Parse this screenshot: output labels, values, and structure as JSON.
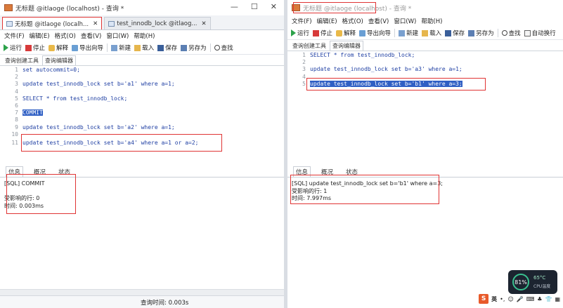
{
  "left": {
    "window_title": "无标题 @itlaoge (localhost) - 查询 *",
    "window_controls": {
      "minimize": "—",
      "maximize": "☐",
      "close": "✕"
    },
    "tabs": [
      {
        "label": "无标题 @itlaoge (localh...",
        "close": "✕"
      },
      {
        "label": "test_innodb_lock @itlaog...",
        "close": "✕"
      }
    ],
    "menu": [
      "文件(F)",
      "编辑(E)",
      "格式(O)",
      "查看(V)",
      "窗口(W)",
      "帮助(H)"
    ],
    "toolbar": {
      "run": "运行",
      "stop": "停止",
      "explain": "解释",
      "export_wizard": "导出向导",
      "new": "新建",
      "load": "载入",
      "save": "保存",
      "save_as": "另存为",
      "find": "查找"
    },
    "subtabs": [
      "查询创建工具",
      "查询编辑器"
    ],
    "code_lines": [
      {
        "n": "1",
        "text": "set autocommit=0;"
      },
      {
        "n": "2",
        "text": ""
      },
      {
        "n": "3",
        "text": "update test_innodb_lock set b='a1' where a=1;"
      },
      {
        "n": "4",
        "text": ""
      },
      {
        "n": "5",
        "text": "SELECT * from test_innodb_lock;"
      },
      {
        "n": "6",
        "text": ""
      },
      {
        "n": "7",
        "text": "COMMIT"
      },
      {
        "n": "8",
        "text": ""
      },
      {
        "n": "9",
        "text": "update test_innodb_lock set b='a2' where a=1;"
      },
      {
        "n": "10",
        "text": ""
      },
      {
        "n": "11",
        "text": "update test_innodb_lock set b='a4' where a=1 or a=2;"
      }
    ],
    "bottom_tabs": [
      "信息",
      "概况",
      "状态"
    ],
    "output_lines": [
      "[SQL] COMMIT",
      "",
      "受影响的行: 0",
      "时间: 0.003ms"
    ],
    "status_text": "查询时间: 0.003s"
  },
  "right": {
    "window_title": "无标题 @itlaoge (localhost) - 查询 *",
    "menu": [
      "文件(F)",
      "编辑(E)",
      "格式(O)",
      "查看(V)",
      "窗口(W)",
      "帮助(H)"
    ],
    "toolbar": {
      "run": "运行",
      "stop": "停止",
      "explain": "解释",
      "export_wizard": "导出向导",
      "new": "新建",
      "load": "载入",
      "save": "保存",
      "save_as": "另存为",
      "find": "查找",
      "auto_wrap": "自动换行"
    },
    "subtabs": [
      "查询创建工具",
      "查询编辑器"
    ],
    "code_lines": [
      {
        "n": "1",
        "text": "SELECT * from test_innodb_lock;"
      },
      {
        "n": "2",
        "text": ""
      },
      {
        "n": "3",
        "text": "update test_innodb_lock set b='a3' where a=1;"
      },
      {
        "n": "4",
        "text": ""
      },
      {
        "n": "5",
        "text": "update test_innodb_lock set b='b1' where a=3;"
      }
    ],
    "bottom_tabs": [
      "信息",
      "概况",
      "状态"
    ],
    "output_lines": [
      "[SQL] update test_innodb_lock set b='b1' where a=3;",
      "受影响的行: 1",
      "时间: 7.997ms"
    ]
  },
  "system": {
    "cpu_usage": "81%",
    "cpu_temp": "65°C",
    "cpu_label": "CPU温度",
    "ime_logo": "S",
    "ime_lang": "英"
  },
  "colors": {
    "highlight": "#2f5fc4",
    "red_box": "#e03434",
    "code": "#1f3fa3"
  }
}
